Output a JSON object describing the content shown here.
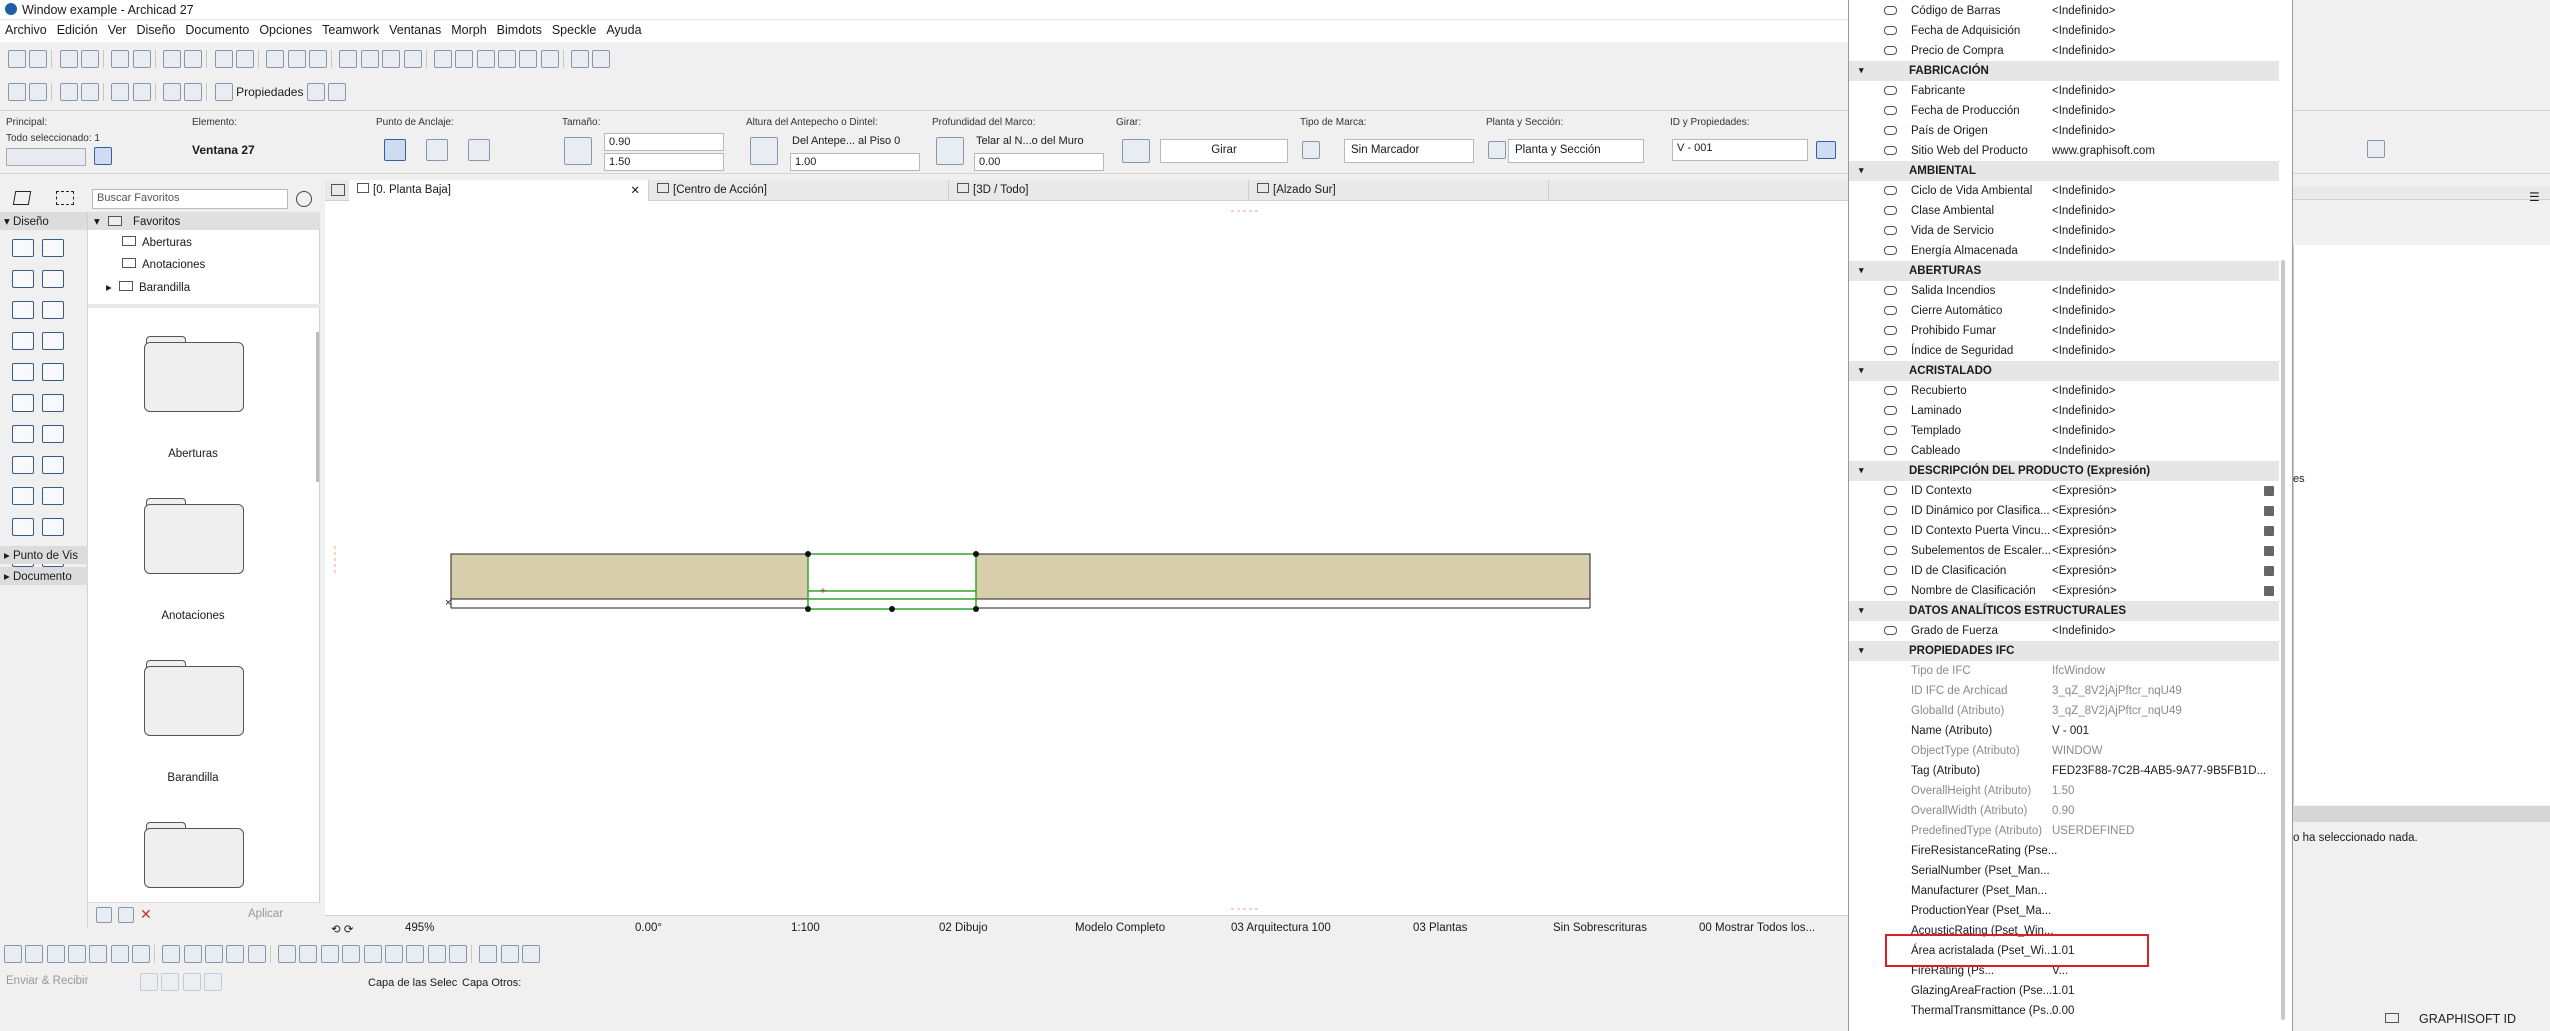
{
  "window": {
    "title": "Window example - Archicad 27"
  },
  "menu": [
    "Archivo",
    "Edición",
    "Ver",
    "Diseño",
    "Documento",
    "Opciones",
    "Teamwork",
    "Ventanas",
    "Morph",
    "Bimdots",
    "Speckle",
    "Ayuda"
  ],
  "toolbar2": {
    "propiedades": "Propiedades"
  },
  "infobox": {
    "principal": "Principal:",
    "todo_sel": "Todo seleccionado: 1",
    "elemento": "Elemento:",
    "elemento_val": "Ventana 27",
    "anclaje": "Punto de Anclaje:",
    "tamano": "Tamaño:",
    "tamano_w": "0.90",
    "tamano_h": "1.50",
    "altura": "Altura del Antepecho o Dintel:",
    "altura_ref": "Del Antepe... al Piso 0",
    "altura_val": "1.00",
    "profundidad": "Profundidad del Marco:",
    "prof_ref": "Telar al N...o del Muro",
    "prof_val": "0.00",
    "girar": "Girar:",
    "girar_btn": "Girar",
    "marca": "Tipo de Marca:",
    "marca_val": "Sin Marcador",
    "planta": "Planta y Sección:",
    "planta_val": "Planta y Sección",
    "id": "ID y Propiedades:",
    "id_val": "V - 001"
  },
  "navigator": {
    "search_placeholder": "Buscar Favoritos",
    "diseno": "Diseño",
    "punto": "Punto de Vis",
    "documento": "Documento",
    "favoritos": "Favoritos",
    "tree": [
      "Aberturas",
      "Anotaciones",
      "Barandilla"
    ],
    "folders": [
      "Aberturas",
      "Anotaciones",
      "Barandilla"
    ],
    "aplicar": "Aplicar"
  },
  "tabs": [
    "[0. Planta Baja]",
    "[Centro de Acción]",
    "[3D / Todo]",
    "[Alzado Sur]"
  ],
  "statusbar": {
    "zoom": "495%",
    "angle": "0.00°",
    "scale": "1:100",
    "layer": "02 Dibujo",
    "model": "Modelo Completo",
    "arch": "03 Arquitectura 100",
    "plantas": "03 Plantas",
    "sobre": "Sin Sobrescrituras",
    "mostrar": "00 Mostrar Todos los..."
  },
  "bottom": {
    "enviar": "Enviar & Recibir",
    "capa_sel": "Capa de las Selec",
    "capa_otros": "Capa Otros:"
  },
  "properties": [
    {
      "n": "Código de Barras",
      "v": "<Indefinido>"
    },
    {
      "n": "Fecha de Adquisición",
      "v": "<Indefinido>"
    },
    {
      "n": "Precio de Compra",
      "v": "<Indefinido>"
    },
    {
      "sec": "FABRICACIÓN"
    },
    {
      "n": "Fabricante",
      "v": "<Indefinido>"
    },
    {
      "n": "Fecha de Producción",
      "v": "<Indefinido>"
    },
    {
      "n": "País de Origen",
      "v": "<Indefinido>"
    },
    {
      "n": "Sitio Web del Producto",
      "v": "www.graphisoft.com"
    },
    {
      "sec": "AMBIENTAL"
    },
    {
      "n": "Ciclo de Vida Ambiental",
      "v": "<Indefinido>"
    },
    {
      "n": "Clase Ambiental",
      "v": "<Indefinido>"
    },
    {
      "n": "Vida de Servicio",
      "v": "<Indefinido>"
    },
    {
      "n": "Energía Almacenada",
      "v": "<Indefinido>"
    },
    {
      "sec": "ABERTURAS"
    },
    {
      "n": "Salida Incendios",
      "v": "<Indefinido>"
    },
    {
      "n": "Cierre Automático",
      "v": "<Indefinido>"
    },
    {
      "n": "Prohibido Fumar",
      "v": "<Indefinido>"
    },
    {
      "n": "Índice de Seguridad",
      "v": "<Indefinido>"
    },
    {
      "sec": "ACRISTALADO"
    },
    {
      "n": "Recubierto",
      "v": "<Indefinido>"
    },
    {
      "n": "Laminado",
      "v": "<Indefinido>"
    },
    {
      "n": "Templado",
      "v": "<Indefinido>"
    },
    {
      "n": "Cableado",
      "v": "<Indefinido>"
    },
    {
      "sec": "DESCRIPCIÓN DEL PRODUCTO (Expresión)"
    },
    {
      "n": "ID Contexto",
      "v": "<Expresión>",
      "calc": true
    },
    {
      "n": "ID Dinámico por Clasifica...",
      "v": "<Expresión>",
      "calc": true
    },
    {
      "n": "ID Contexto Puerta Vincu...",
      "v": "<Expresión>",
      "calc": true
    },
    {
      "n": "Subelementos de Escaler...",
      "v": "<Expresión>",
      "calc": true
    },
    {
      "n": "ID de Clasificación",
      "v": "<Expresión>",
      "calc": true
    },
    {
      "n": "Nombre de Clasificación",
      "v": "<Expresión>",
      "calc": true
    },
    {
      "sec": "DATOS ANALÍTICOS ESTRUCTURALES"
    },
    {
      "n": "Grado de Fuerza",
      "v": "<Indefinido>"
    },
    {
      "sec": "PROPIEDADES IFC"
    },
    {
      "n": "Tipo de IFC",
      "v": "IfcWindow",
      "gray": true,
      "noicon": true
    },
    {
      "n": "ID IFC de Archicad",
      "v": "3_qZ_8V2jAjPftcr_nqU49",
      "gray": true,
      "noicon": true
    },
    {
      "n": "GlobalId (Atributo)",
      "v": "3_qZ_8V2jAjPftcr_nqU49",
      "gray": true,
      "noicon": true
    },
    {
      "n": "Name (Atributo)",
      "v": "V - 001",
      "noicon": true
    },
    {
      "n": "ObjectType (Atributo)",
      "v": "WINDOW",
      "gray": true,
      "noicon": true
    },
    {
      "n": "Tag (Atributo)",
      "v": "FED23F88-7C2B-4AB5-9A77-9B5FB1D...",
      "noicon": true
    },
    {
      "n": "OverallHeight (Atributo)",
      "v": "1.50",
      "gray": true,
      "noicon": true
    },
    {
      "n": "OverallWidth (Atributo)",
      "v": "0.90",
      "gray": true,
      "noicon": true
    },
    {
      "n": "PredefinedType (Atributo)",
      "v": "USERDEFINED",
      "gray": true,
      "noicon": true
    },
    {
      "n": "FireResistanceRating (Pse...",
      "v": "",
      "noicon": true
    },
    {
      "n": "SerialNumber (Pset_Man...",
      "v": "",
      "noicon": true
    },
    {
      "n": "Manufacturer (Pset_Man...",
      "v": "",
      "noicon": true
    },
    {
      "n": "ProductionYear (Pset_Ma...",
      "v": "",
      "noicon": true
    },
    {
      "n": "AcousticRating (Pset_Win...",
      "v": "",
      "noicon": true
    },
    {
      "n": "Área acristalada (Pset_Wi...",
      "v": "1.01",
      "noicon": true,
      "highlight": true
    },
    {
      "n": "FireRating (Ps...",
      "v": "V...",
      "noicon": true
    },
    {
      "n": "GlazingAreaFraction (Pse...",
      "v": "1.01",
      "noicon": true
    },
    {
      "n": "ThermalTransmittance (Ps...",
      "v": "0.00",
      "noicon": true
    }
  ],
  "right": {
    "es": "es",
    "none": "o ha seleccionado nada.",
    "brand": "GRAPHISOFT ID"
  },
  "colors": {
    "wall": "#d8ceac",
    "selection": "#2da82d",
    "highlight": "#d9202a"
  }
}
